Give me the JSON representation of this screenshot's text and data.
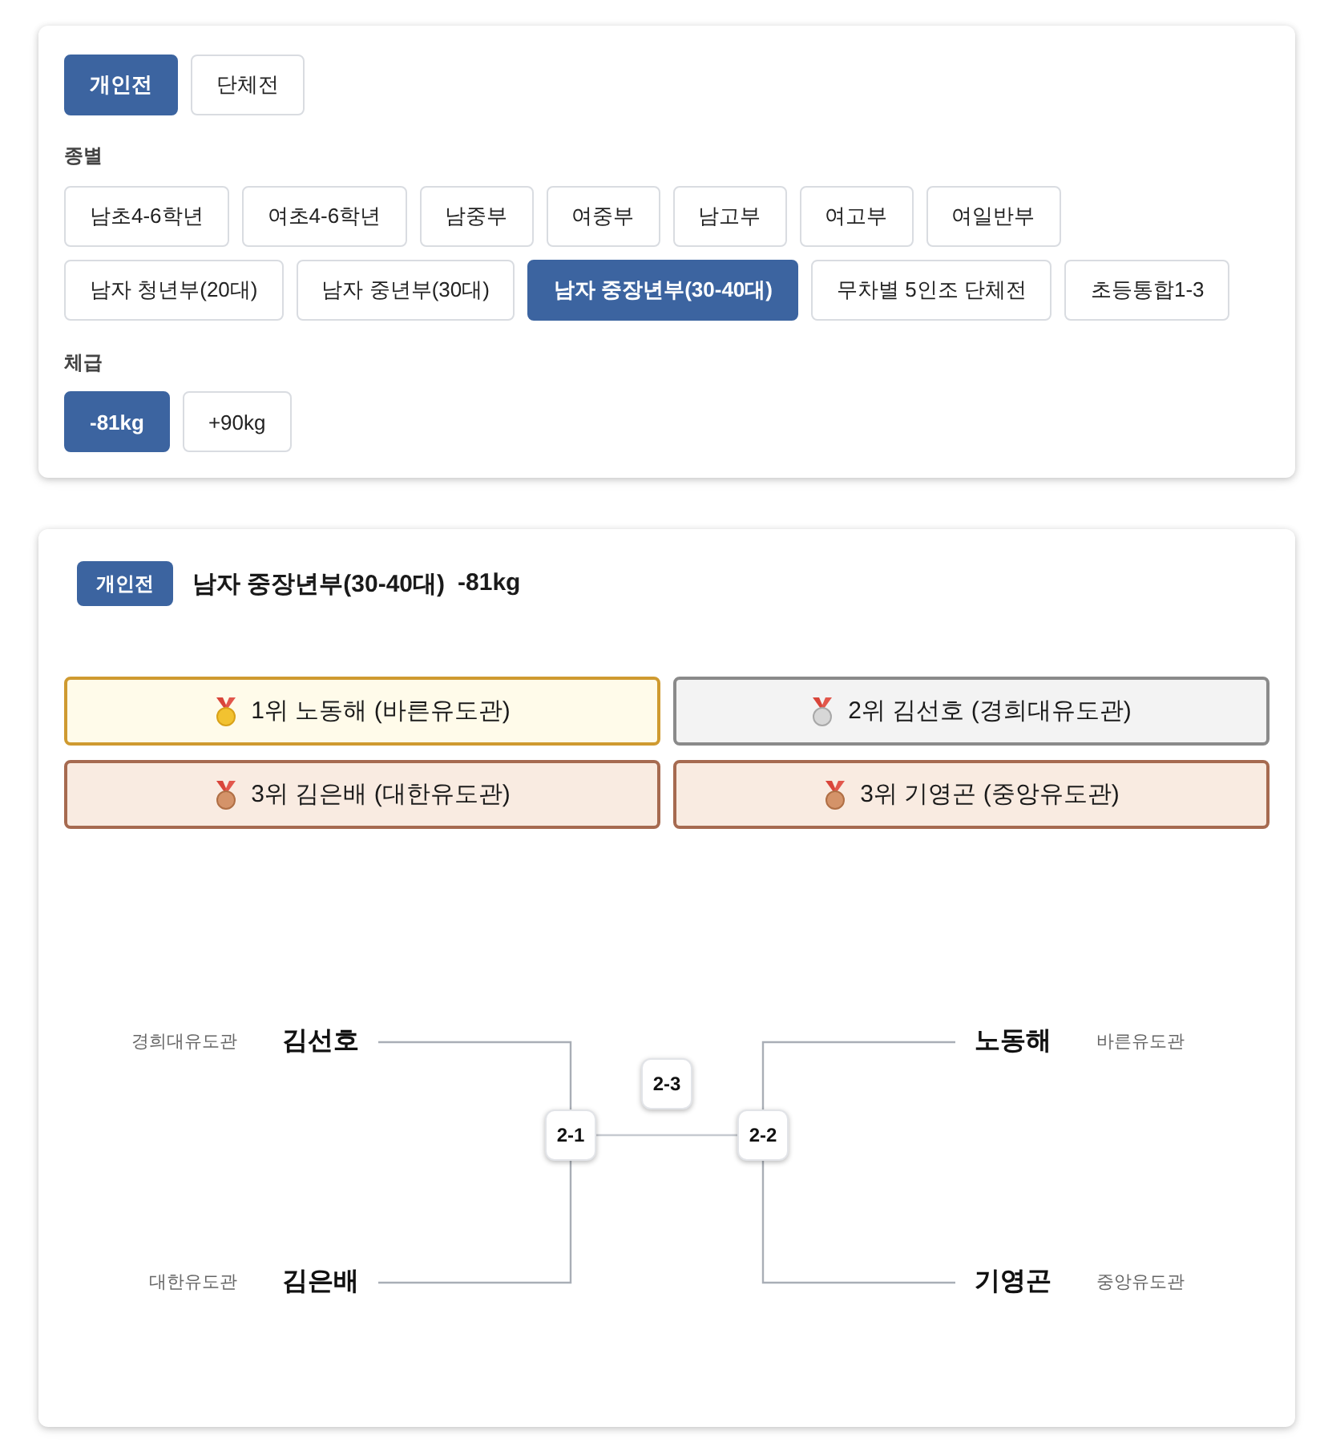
{
  "tabs": [
    {
      "label": "개인전",
      "selected": true
    },
    {
      "label": "단체전",
      "selected": false
    }
  ],
  "divisions": {
    "label": "종별",
    "options": [
      {
        "label": "남초4-6학년",
        "selected": false
      },
      {
        "label": "여초4-6학년",
        "selected": false
      },
      {
        "label": "남중부",
        "selected": false
      },
      {
        "label": "여중부",
        "selected": false
      },
      {
        "label": "남고부",
        "selected": false
      },
      {
        "label": "여고부",
        "selected": false
      },
      {
        "label": "여일반부",
        "selected": false
      },
      {
        "label": "남자 청년부(20대)",
        "selected": false
      },
      {
        "label": "남자 중년부(30대)",
        "selected": false
      },
      {
        "label": "남자 중장년부(30-40대)",
        "selected": true
      },
      {
        "label": "무차별 5인조 단체전",
        "selected": false
      },
      {
        "label": "초등통합1-3",
        "selected": false
      }
    ]
  },
  "weights": {
    "label": "체급",
    "options": [
      {
        "label": "-81kg",
        "selected": true
      },
      {
        "label": "+90kg",
        "selected": false
      }
    ]
  },
  "result": {
    "badge": "개인전",
    "division": "남자 중장년부(30-40대)",
    "weight": "-81kg",
    "medals": [
      {
        "kind": "gold",
        "text": "1위 노동해 (바른유도관)"
      },
      {
        "kind": "silver",
        "text": "2위 김선호 (경희대유도관)"
      },
      {
        "kind": "bronze",
        "text": "3위 김은배 (대한유도관)"
      },
      {
        "kind": "bronze",
        "text": "3위 기영곤 (중앙유도관)"
      }
    ],
    "bracket": {
      "left": {
        "match": "2-1",
        "players": [
          {
            "name": "김선호",
            "club": "경희대유도관"
          },
          {
            "name": "김은배",
            "club": "대한유도관"
          }
        ]
      },
      "final": {
        "match": "2-3"
      },
      "right": {
        "match": "2-2",
        "players": [
          {
            "name": "노동해",
            "club": "바른유도관"
          },
          {
            "name": "기영곤",
            "club": "중앙유도관"
          }
        ]
      }
    }
  }
}
